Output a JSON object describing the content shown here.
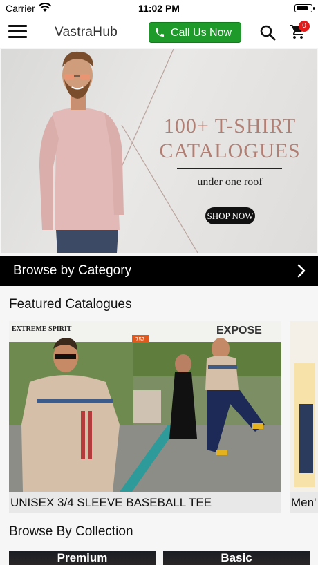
{
  "status_bar": {
    "carrier": "Carrier",
    "time": "11:02 PM",
    "battery_level": 0.8
  },
  "header": {
    "menu_icon": "hamburger-icon",
    "title": "VastraHub",
    "call_button_label": "Call Us Now",
    "call_icon": "phone-icon",
    "search_icon": "search-icon",
    "cart_icon": "cart-icon",
    "cart_count": "0",
    "call_color": "#1e9a2a",
    "badge_color": "#e31b1b"
  },
  "banner": {
    "heading_line1": "100+ T-SHIRT",
    "heading_line2": "CATALOGUES",
    "subtitle": "under one roof",
    "cta": "SHOP NOW",
    "heading_color": "#b07f74"
  },
  "category_bar": {
    "label": "Browse by Category",
    "icon": "chevron-right-icon"
  },
  "featured": {
    "title": "Featured Catalogues",
    "items": [
      {
        "caption": "UNISEX 3/4 SLEEVE BASEBALL TEE",
        "image_text_left": "EXTREME SPIRIT",
        "image_brand": "EXPOSE",
        "image_tag": "757"
      },
      {
        "caption": "Men'"
      }
    ]
  },
  "collections": {
    "title": "Browse By Collection",
    "items": [
      {
        "name": "Premium"
      },
      {
        "name": "Basic"
      }
    ]
  }
}
